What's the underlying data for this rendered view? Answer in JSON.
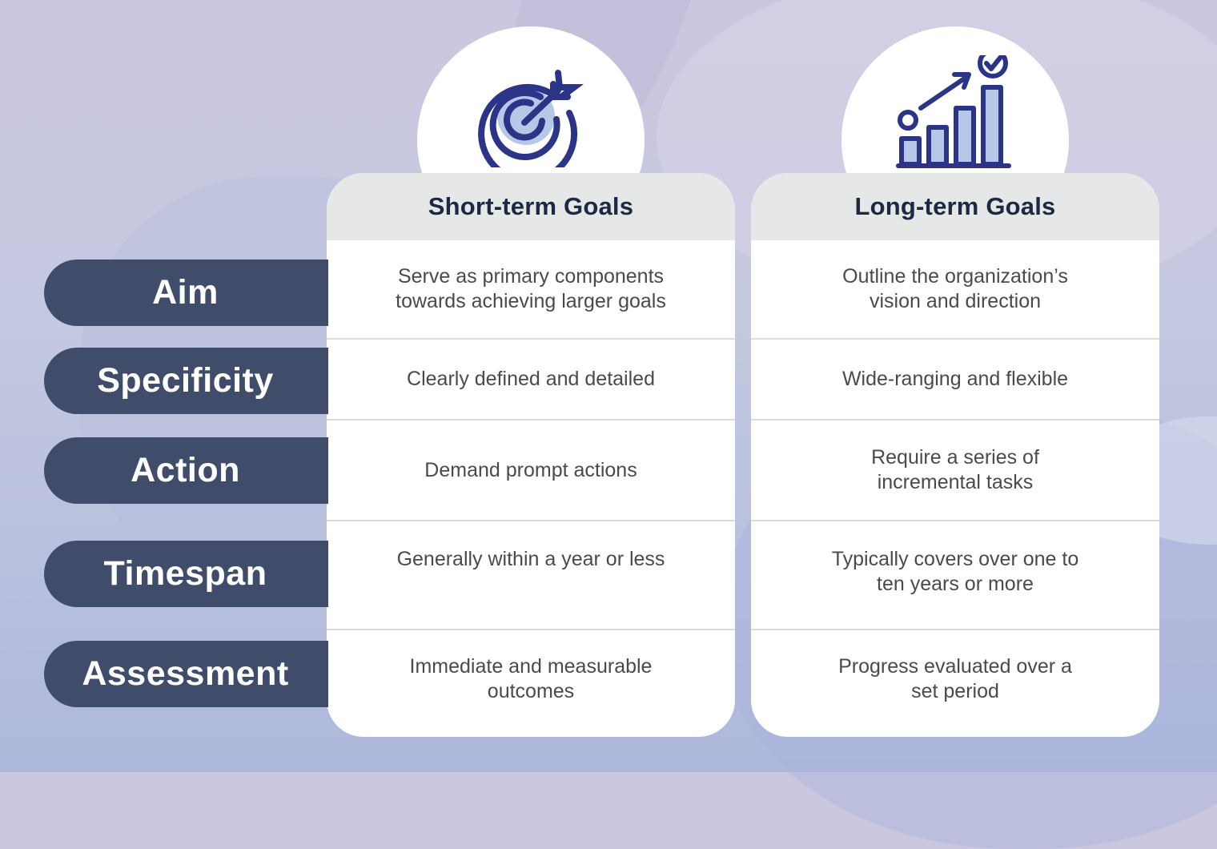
{
  "columns": {
    "short": {
      "title": "Short-term Goals",
      "icon": "target-arrow-icon"
    },
    "long": {
      "title": "Long-term Goals",
      "icon": "growth-chart-check-icon"
    }
  },
  "rows": [
    {
      "label": "Aim",
      "short": [
        "Serve as primary components",
        "towards achieving larger goals"
      ],
      "long": [
        "Outline the organization’s",
        "vision and direction"
      ]
    },
    {
      "label": "Specificity",
      "short": [
        "Clearly defined and detailed"
      ],
      "long": [
        "Wide-ranging and flexible"
      ]
    },
    {
      "label": "Action",
      "short": [
        "Demand prompt actions"
      ],
      "long": [
        "Require a series of",
        "incremental tasks"
      ]
    },
    {
      "label": "Timespan",
      "short": [
        "Generally within a year or less"
      ],
      "long": [
        "Typically covers over one to",
        "ten years or more"
      ]
    },
    {
      "label": "Assessment",
      "short": [
        "Immediate and measurable",
        "outcomes"
      ],
      "long": [
        "Progress evaluated over a",
        "set period"
      ]
    }
  ],
  "colors": {
    "label_bg": "#3f4d6b",
    "icon_stroke": "#2b3487",
    "icon_fill": "#b5c8e8",
    "header_bg": "#e6e8e8",
    "header_text": "#1b2a44"
  }
}
